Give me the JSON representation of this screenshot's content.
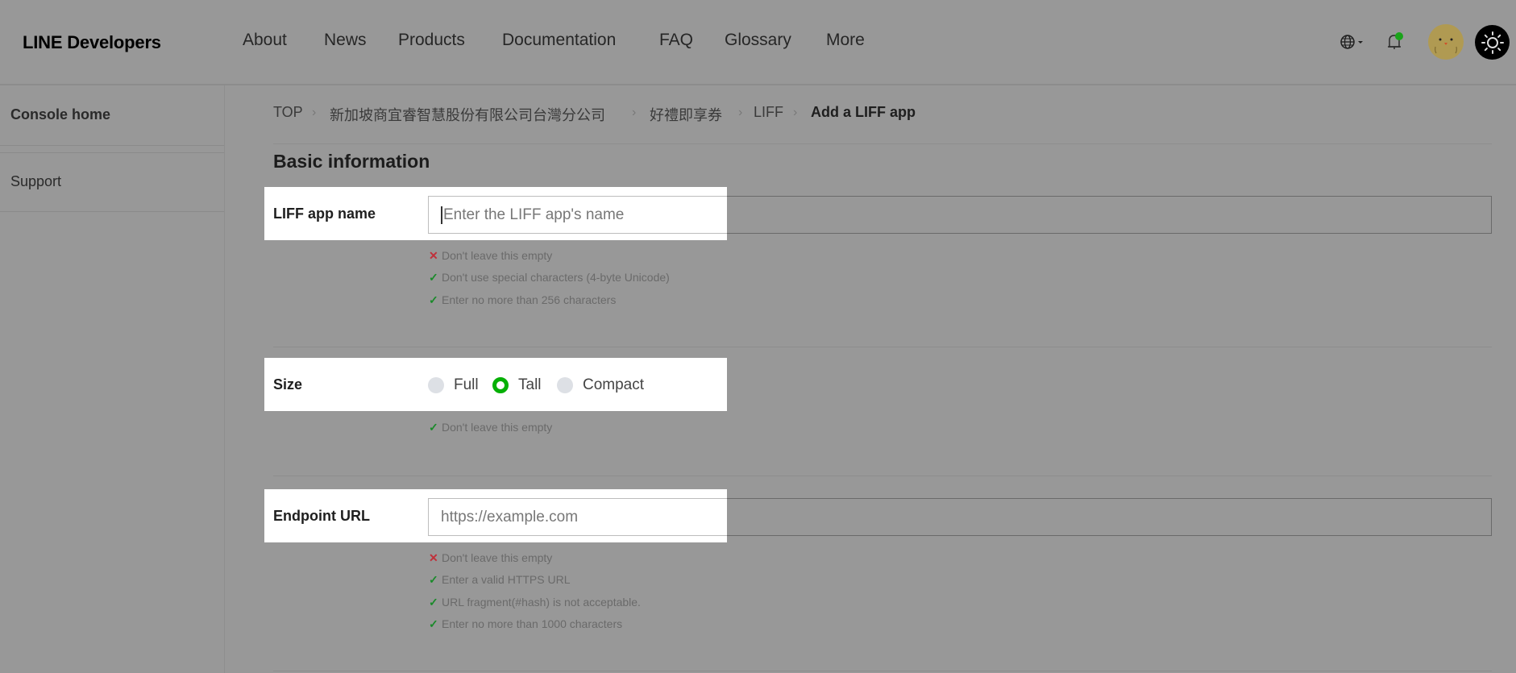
{
  "header": {
    "logo": "LINE Developers",
    "nav": [
      "About",
      "News",
      "Products",
      "Documentation",
      "FAQ",
      "Glossary",
      "More"
    ],
    "icons": {
      "language": "globe-icon",
      "notifications": "bell-icon",
      "avatar": "user-avatar",
      "theme": "sun-icon"
    },
    "notification_dot_color": "#1aa31a"
  },
  "sidebar": {
    "items": [
      {
        "label": "Console home",
        "bold": true
      },
      {
        "label": "Support",
        "bold": false
      }
    ]
  },
  "breadcrumb": [
    "TOP",
    "新加坡商宜睿智慧股份有限公司台灣分公司",
    "好禮即享券",
    "LIFF",
    "Add a LIFF app"
  ],
  "section_title": "Basic information",
  "fields": {
    "app_name": {
      "label": "LIFF app name",
      "placeholder": "Enter the LIFF app's name",
      "value": "",
      "validations": [
        {
          "status": "error",
          "text": "Don't leave this empty"
        },
        {
          "status": "ok",
          "text": "Don't use special characters (4-byte Unicode)"
        },
        {
          "status": "ok",
          "text": "Enter no more than 256 characters"
        }
      ]
    },
    "size": {
      "label": "Size",
      "options": [
        "Full",
        "Tall",
        "Compact"
      ],
      "selected": "Tall",
      "validations": [
        {
          "status": "ok",
          "text": "Don't leave this empty"
        }
      ]
    },
    "endpoint_url": {
      "label": "Endpoint URL",
      "placeholder": "https://example.com",
      "value": "",
      "validations": [
        {
          "status": "error",
          "text": "Don't leave this empty"
        },
        {
          "status": "ok",
          "text": "Enter a valid HTTPS URL"
        },
        {
          "status": "ok",
          "text": "URL fragment(#hash) is not acceptable."
        },
        {
          "status": "ok",
          "text": "Enter no more than 1000 characters"
        }
      ]
    }
  },
  "colors": {
    "accent_green": "#06b006",
    "error_red": "#c0303a",
    "ok_green": "#1a8a2a"
  }
}
